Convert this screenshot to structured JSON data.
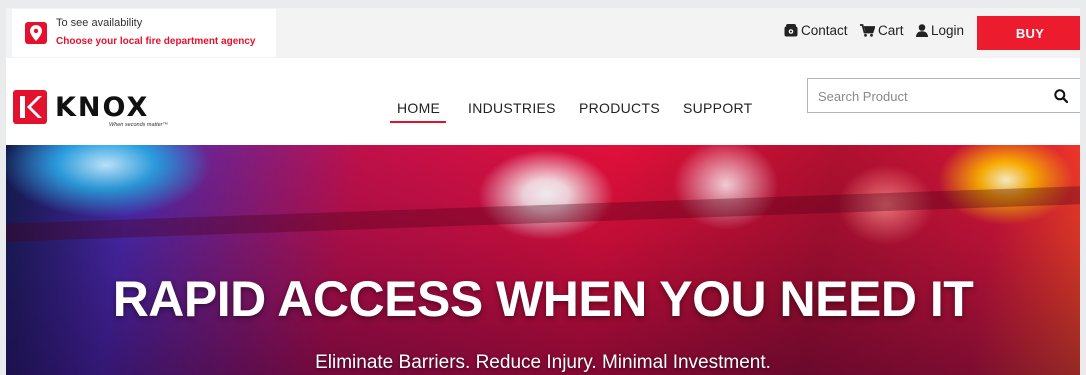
{
  "agency": {
    "line1": "To see availability",
    "line2": "Choose your local fire department agency"
  },
  "utility": {
    "contact": "Contact",
    "cart": "Cart",
    "login": "Login",
    "buy": "BUY"
  },
  "logo": {
    "wordmark": "KNOX",
    "tagline": "When seconds matter™"
  },
  "nav": {
    "items": [
      {
        "label": "HOME",
        "active": true
      },
      {
        "label": "INDUSTRIES",
        "active": false
      },
      {
        "label": "PRODUCTS",
        "active": false
      },
      {
        "label": "SUPPORT",
        "active": false
      }
    ]
  },
  "search": {
    "placeholder": "Search Product",
    "value": ""
  },
  "hero": {
    "title": "RAPID ACCESS WHEN YOU NEED IT",
    "subtitle": "Eliminate Barriers. Reduce Injury. Minimal Investment."
  },
  "colors": {
    "brand_red": "#e3112e",
    "buy_button": "#ec1b2e",
    "topbar_bg": "#f3f3f3"
  },
  "icons": {
    "agency": "location-pin-icon",
    "contact": "phone-icon",
    "cart": "cart-icon",
    "login": "user-icon",
    "search": "search-icon"
  }
}
